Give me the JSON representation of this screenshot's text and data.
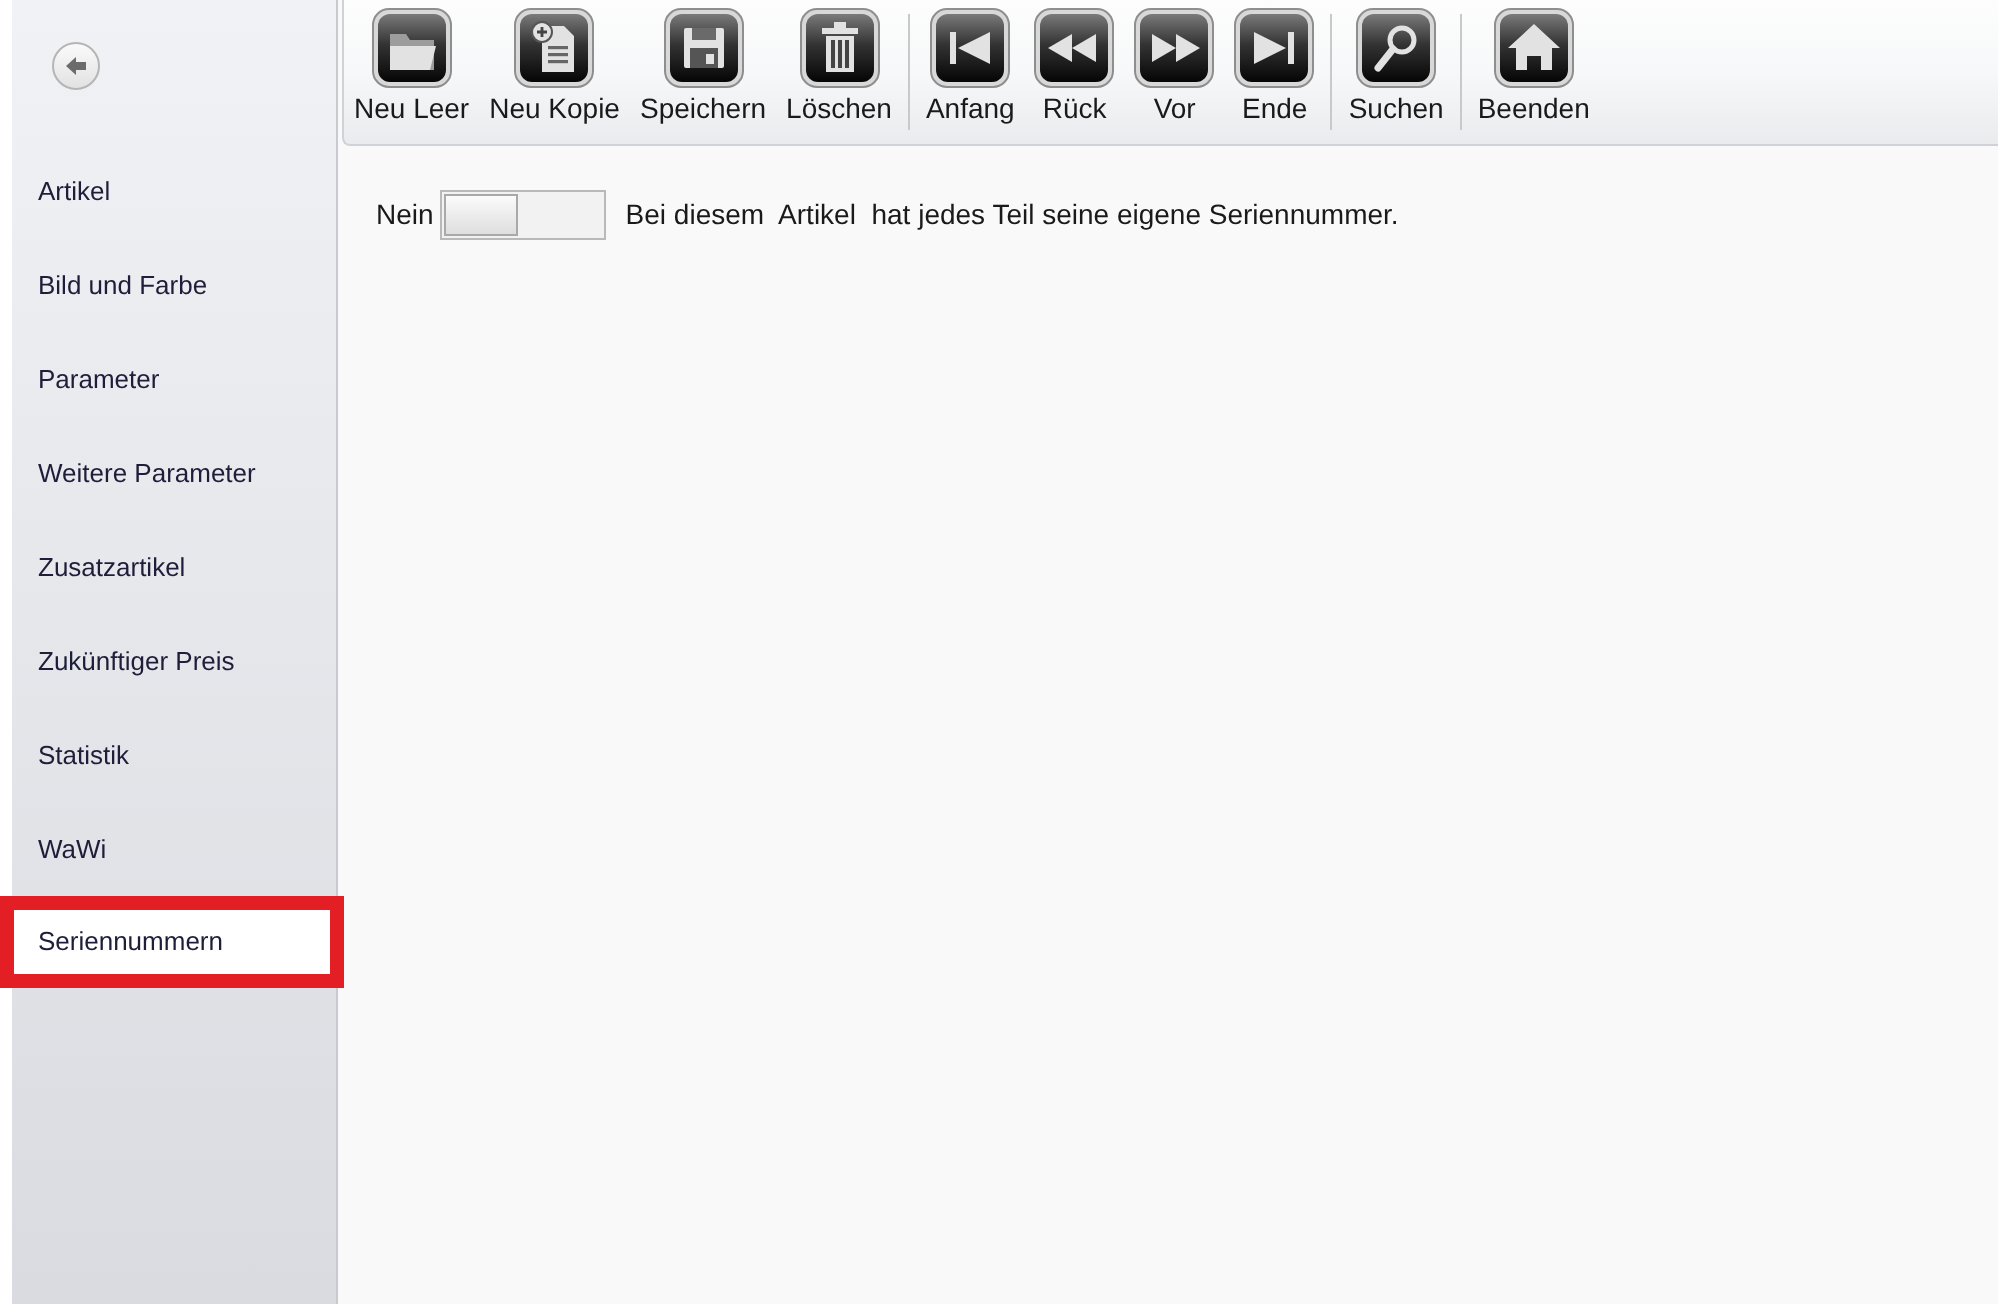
{
  "sidebar": {
    "items": [
      {
        "label": "Artikel",
        "selected": false
      },
      {
        "label": "Bild und Farbe",
        "selected": false
      },
      {
        "label": "Parameter",
        "selected": false
      },
      {
        "label": "Weitere Parameter",
        "selected": false
      },
      {
        "label": "Zusatzartikel",
        "selected": false
      },
      {
        "label": "Zukünftiger Preis",
        "selected": false
      },
      {
        "label": "Statistik",
        "selected": false
      },
      {
        "label": "WaWi",
        "selected": false
      },
      {
        "label": "Seriennummern",
        "selected": true
      }
    ]
  },
  "toolbar": {
    "groups": [
      {
        "buttons": [
          {
            "label": "Neu Leer",
            "kind": "folder"
          },
          {
            "label": "Neu Kopie",
            "kind": "document-plus"
          },
          {
            "label": "Speichern",
            "kind": "floppy"
          },
          {
            "label": "Löschen",
            "kind": "trash"
          }
        ]
      },
      {
        "buttons": [
          {
            "label": "Anfang",
            "kind": "first"
          },
          {
            "label": "Rück",
            "kind": "previous"
          },
          {
            "label": "Vor",
            "kind": "next"
          },
          {
            "label": "Ende",
            "kind": "last"
          }
        ]
      },
      {
        "buttons": [
          {
            "label": "Suchen",
            "kind": "search"
          }
        ]
      },
      {
        "buttons": [
          {
            "label": "Beenden",
            "kind": "home"
          }
        ]
      }
    ]
  },
  "serial_number_setting": {
    "toggle": {
      "label": "Nein",
      "on": false
    },
    "description": "Bei diesem  Artikel  hat jedes Teil seine eigene Seriennummer."
  }
}
